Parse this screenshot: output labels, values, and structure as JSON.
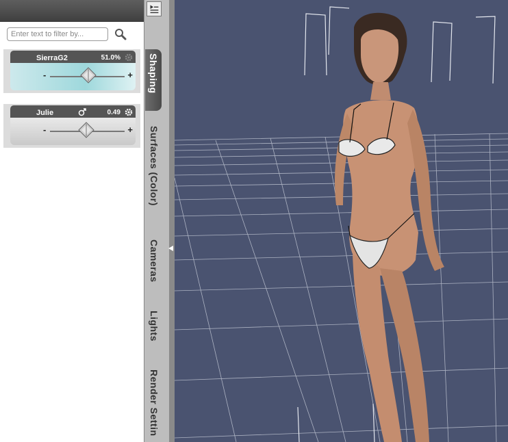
{
  "filter": {
    "placeholder": "Enter text to filter by..."
  },
  "icons": {
    "search": "magnifier-icon",
    "menu": "panel-menu-icon",
    "gear": "gear-icon",
    "gender": "male-female-icon",
    "collapse": "left-arrow-icon"
  },
  "morphs": [
    {
      "name": "SierraG2",
      "value": "51.0%",
      "slider_fraction": 0.51,
      "selected": true
    },
    {
      "name": "Julie",
      "value": "0.49",
      "slider_fraction": 0.49,
      "selected": false
    }
  ],
  "tabs": [
    {
      "label": "Shaping",
      "active": true
    },
    {
      "label": "Surfaces (Color)",
      "active": false
    },
    {
      "label": "Cameras",
      "active": false
    },
    {
      "label": "Lights",
      "active": false
    },
    {
      "label": "Render Settin",
      "active": false
    }
  ],
  "colors": {
    "viewport_bg": "#4a5370",
    "grid": "#d8dce6",
    "selected_card": "#9ed8dc",
    "panel_header": "#4a4a4a"
  }
}
